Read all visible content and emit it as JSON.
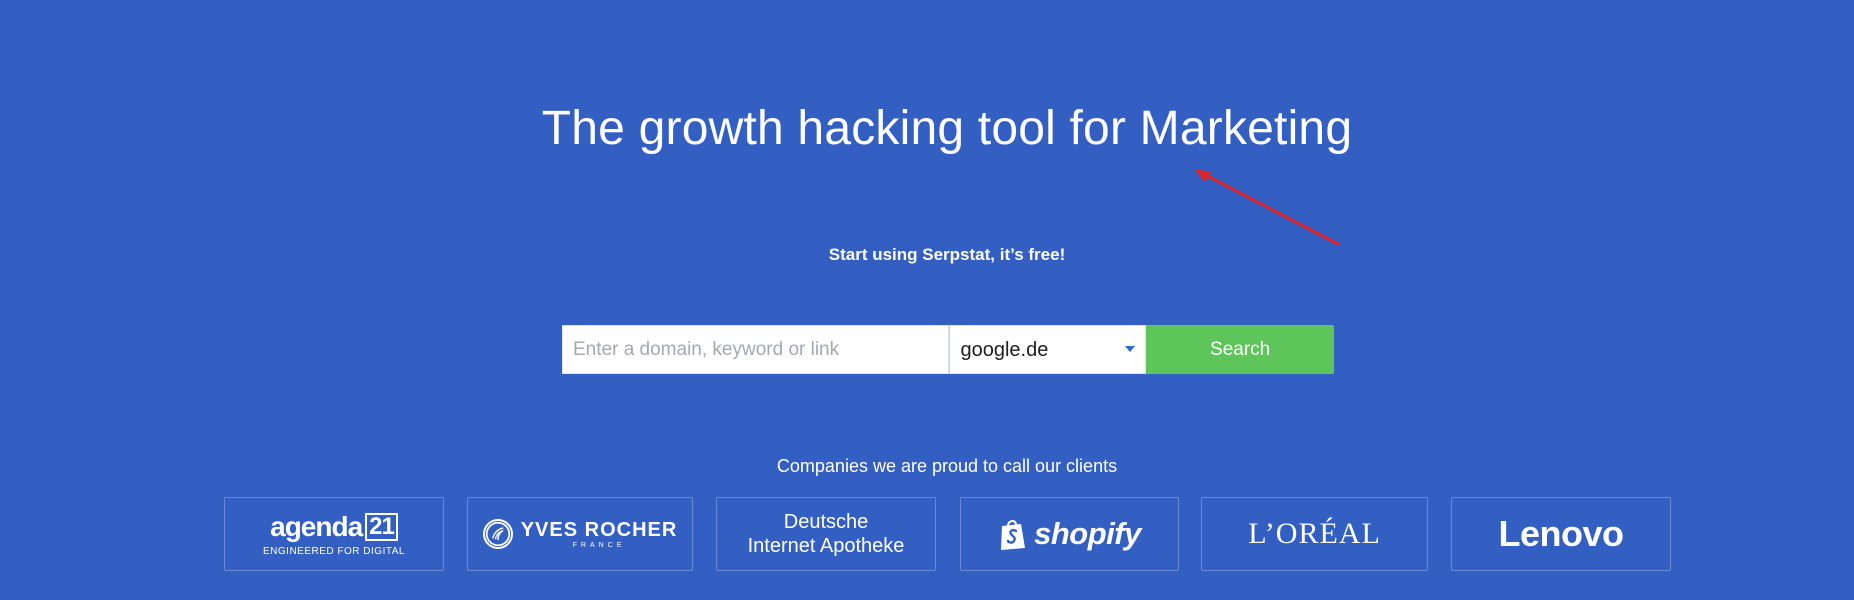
{
  "hero": {
    "title": "The growth hacking tool for Marketing",
    "subtitle": "Start using Serpstat, it’s free!"
  },
  "search": {
    "placeholder": "Enter a domain, keyword or link",
    "engine": "google.de",
    "button_label": "Search"
  },
  "clients": {
    "caption": "Companies we are proud to call our clients",
    "logos": [
      {
        "name": "agenda",
        "number": "21",
        "tagline": "ENGINEERED FOR DIGITAL"
      },
      {
        "name": "YVES ROCHER",
        "sub": "FRANCE"
      },
      {
        "line1": "Deutsche",
        "line2": "Internet Apotheke"
      },
      {
        "name": "shopify"
      },
      {
        "name": "L’ORÉAL"
      },
      {
        "name": "Lenovo"
      }
    ]
  },
  "colors": {
    "background": "#335ec2",
    "search_button": "#5ec55a",
    "annotation_arrow": "#e0252a"
  },
  "icons": [
    "chevron-down-icon",
    "shopify-bag-icon",
    "yves-rocher-emblem-icon",
    "arrow-annotation"
  ]
}
